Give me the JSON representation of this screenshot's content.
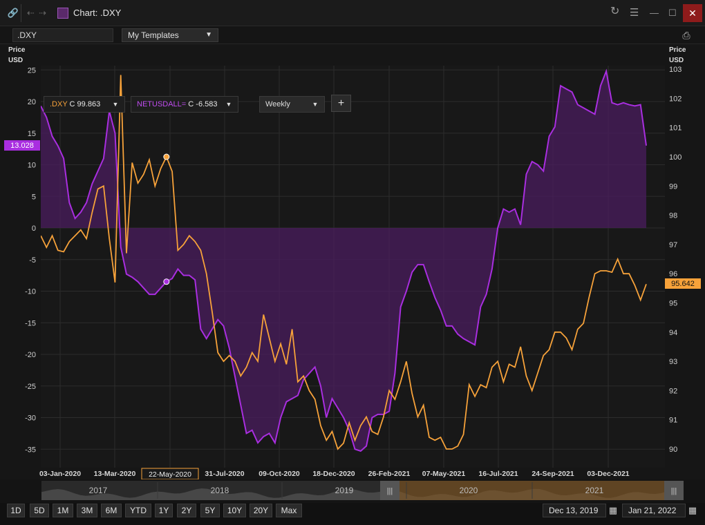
{
  "window": {
    "title": "Chart: .DXY"
  },
  "toolbar": {
    "ric": ".DXY",
    "templates": "My Templates"
  },
  "legend": {
    "dxy_name": ".DXY",
    "dxy_value": "C 99.863",
    "net_name": "NETUSDALL=",
    "net_value": "C -6.583",
    "interval": "Weekly",
    "add": "+"
  },
  "axes": {
    "left_title_1": "Price",
    "left_title_2": "USD",
    "right_title_1": "Price",
    "right_title_2": "USD"
  },
  "markers": {
    "left_tag": "13.028",
    "right_tag": "95.642",
    "cursor_date": "22-May-2020"
  },
  "navigator": {
    "years": [
      "2017",
      "2018",
      "2019",
      "2020",
      "2021"
    ]
  },
  "range_buttons": [
    "1D",
    "5D",
    "1M",
    "3M",
    "6M",
    "YTD",
    "1Y",
    "2Y",
    "5Y",
    "10Y",
    "20Y",
    "Max"
  ],
  "dates": {
    "start": "Dec 13, 2019",
    "end": "Jan 21, 2022"
  },
  "colors": {
    "dxy": "#f7a23a",
    "net": "#a92ee0",
    "net_fill": "#5b2272",
    "bg": "#161616",
    "grid": "#2c2c2c",
    "tag_bg": "#f7a23a",
    "cursor_tag": "#f7a23a"
  },
  "chart_data": {
    "type": "line",
    "x_ticks": [
      "03-Jan-2020",
      "13-Mar-2020",
      "22-May-2020",
      "31-Jul-2020",
      "09-Oct-2020",
      "18-Dec-2020",
      "26-Feb-2021",
      "07-May-2021",
      "16-Jul-2021",
      "24-Sep-2021",
      "03-Dec-2021"
    ],
    "y_left": {
      "ticks": [
        25,
        20,
        15,
        10,
        5,
        0,
        -5,
        -10,
        -15,
        -20,
        -25,
        -30,
        -35
      ],
      "range": [
        -36,
        26
      ]
    },
    "y_right": {
      "ticks": [
        103,
        102,
        101,
        100,
        99,
        98,
        97,
        96,
        95,
        94,
        93,
        92,
        91,
        90
      ],
      "range": [
        89.75,
        103.3
      ]
    },
    "series": [
      {
        "name": ".DXY",
        "axis": "right",
        "values": [
          97.3,
          96.9,
          97.3,
          96.8,
          96.75,
          97.1,
          97.3,
          97.5,
          97.2,
          98.1,
          98.9,
          99.0,
          97.2,
          95.7,
          102.8,
          96.7,
          99.8,
          99.1,
          99.4,
          99.9,
          99.0,
          99.6,
          100.0,
          99.5,
          96.8,
          97.0,
          97.3,
          97.1,
          96.8,
          96.0,
          94.7,
          93.3,
          93.0,
          93.2,
          93.0,
          92.5,
          92.8,
          93.3,
          93.0,
          94.6,
          93.8,
          93.0,
          93.6,
          92.9,
          94.1,
          92.3,
          92.5,
          92.0,
          91.7,
          90.8,
          90.3,
          90.6,
          90.0,
          90.2,
          90.9,
          90.3,
          90.8,
          91.1,
          90.6,
          90.5,
          91.1,
          92.0,
          91.7,
          92.3,
          93.0,
          91.9,
          91.1,
          91.5,
          90.4,
          90.3,
          90.4,
          90.0,
          90.0,
          90.1,
          90.5,
          92.2,
          91.8,
          92.2,
          92.1,
          92.8,
          93.0,
          92.3,
          92.9,
          92.8,
          93.5,
          92.5,
          92.0,
          92.6,
          93.2,
          93.4,
          94.0,
          94.0,
          93.8,
          93.4,
          94.1,
          94.3,
          95.2,
          96.0,
          96.1,
          96.1,
          96.05,
          96.5,
          96.0,
          96.0,
          95.6,
          95.1,
          95.642
        ]
      },
      {
        "name": "NETUSDALL=",
        "axis": "left",
        "values": [
          19.3,
          17.5,
          14.5,
          13.0,
          11.0,
          4.0,
          1.5,
          2.5,
          4.0,
          7.0,
          9.0,
          11.0,
          18.5,
          15.0,
          -3.0,
          -7.3,
          -7.8,
          -8.5,
          -9.5,
          -10.5,
          -10.5,
          -9.5,
          -8.5,
          -8.0,
          -6.5,
          -7.5,
          -7.5,
          -8.2,
          -16.0,
          -17.5,
          -16.0,
          -14.5,
          -15.5,
          -19.0,
          -23.5,
          -28.0,
          -32.5,
          -32.0,
          -34.0,
          -33.0,
          -32.5,
          -34.0,
          -30.0,
          -27.5,
          -27.0,
          -26.5,
          -24.0,
          -23.0,
          -22.0,
          -25.0,
          -30.0,
          -27.0,
          -28.5,
          -30.0,
          -32.0,
          -35.0,
          -35.3,
          -34.5,
          -30.0,
          -29.5,
          -29.5,
          -29.0,
          -23.0,
          -12.5,
          -10.0,
          -7.0,
          -5.8,
          -5.8,
          -8.5,
          -11.0,
          -13.0,
          -15.5,
          -15.5,
          -16.8,
          -17.5,
          -18.0,
          -18.5,
          -12.5,
          -10.5,
          -6.5,
          0.0,
          3.0,
          2.5,
          3.0,
          0.5,
          8.5,
          10.5,
          10.0,
          9.0,
          14.5,
          16.0,
          22.5,
          22.0,
          21.5,
          19.5,
          19.0,
          18.5,
          18.0,
          22.5,
          24.8,
          19.8,
          19.5,
          19.8,
          19.5,
          19.3,
          19.5,
          13.028
        ]
      }
    ]
  }
}
